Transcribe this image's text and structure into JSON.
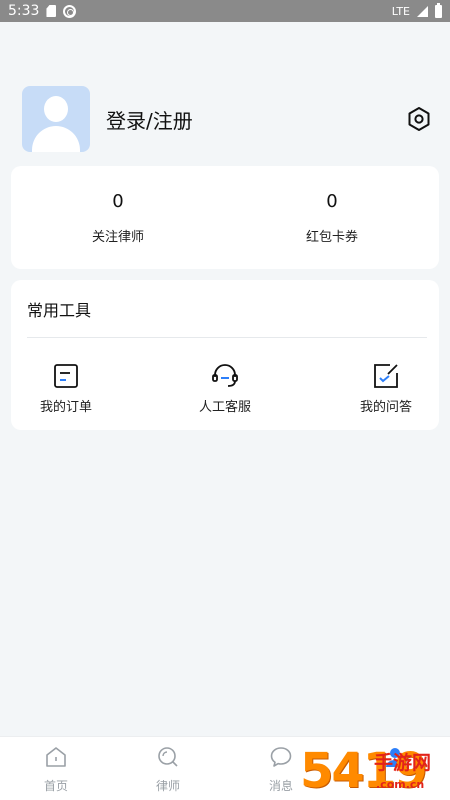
{
  "status_bar": {
    "time": "5:33",
    "network": "LTE"
  },
  "profile": {
    "login_label": "登录/注册"
  },
  "stats": [
    {
      "value": "0",
      "label": "关注律师"
    },
    {
      "value": "0",
      "label": "红包卡券"
    }
  ],
  "tools": {
    "title": "常用工具",
    "items": [
      {
        "label": "我的订单",
        "icon": "order-icon"
      },
      {
        "label": "人工客服",
        "icon": "headset-icon"
      },
      {
        "label": "我的问答",
        "icon": "qa-icon"
      }
    ]
  },
  "tabbar": {
    "items": [
      {
        "label": "首页",
        "icon": "home-icon"
      },
      {
        "label": "律师",
        "icon": "lawyer-icon"
      },
      {
        "label": "消息",
        "icon": "message-icon"
      },
      {
        "label": "",
        "icon": "profile-icon"
      }
    ]
  },
  "colors": {
    "background": "#f3f6f8",
    "card": "#ffffff",
    "accent": "#2d7ff9",
    "tab_inactive": "#9aa0a6"
  },
  "watermark": {
    "number": "5419",
    "brand": "手游网",
    "domain": ".com.cn"
  }
}
